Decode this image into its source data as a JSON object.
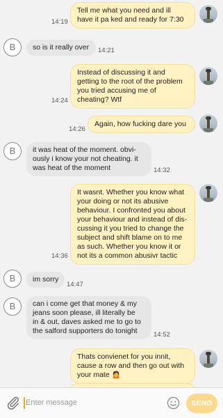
{
  "incoming_avatar_letter": "B",
  "messages": [
    {
      "text": "Tell me what you need and ill\nhave it pa ked and ready for 7:30",
      "time": "14:19"
    },
    {
      "text": "so is it really over",
      "time": "14:21"
    },
    {
      "text": "Instead of discussing it and\ngetting to the root of the problem\nyou tried accusing me of\ncheating? Wtf",
      "time": "14:24"
    },
    {
      "text": "Again, how fucking dare you",
      "time": "14:26"
    },
    {
      "text": "it was heat of the moment. obvi-\nously i know your not cheating. it\nwas heat of the moment",
      "time": "14:32"
    },
    {
      "text": "It wasnt. Whether you know what\nyour doing or not its abusive\nbehaviour. I confronted you about\nyour behaviour and instead of dis-\ncussing it you tried to change the\nsubject and shift blame on to me\nas such. Whether you know it or\nnot its a common abusivr tactic",
      "time": "14:36"
    },
    {
      "text": "im sorry",
      "time": "14:47"
    },
    {
      "text": "can i come get that money & my\njeans soon please, ill literally be\nin & out, daves asked me to go to\nthe salford supporters do tonight",
      "time": "14:52"
    },
    {
      "text": "Thats convienet for you innit,\ncause a row and then go out with\nyour mate 🙍",
      "time": ""
    }
  ],
  "composer": {
    "placeholder": "Enter message",
    "send_label": "SEND"
  }
}
